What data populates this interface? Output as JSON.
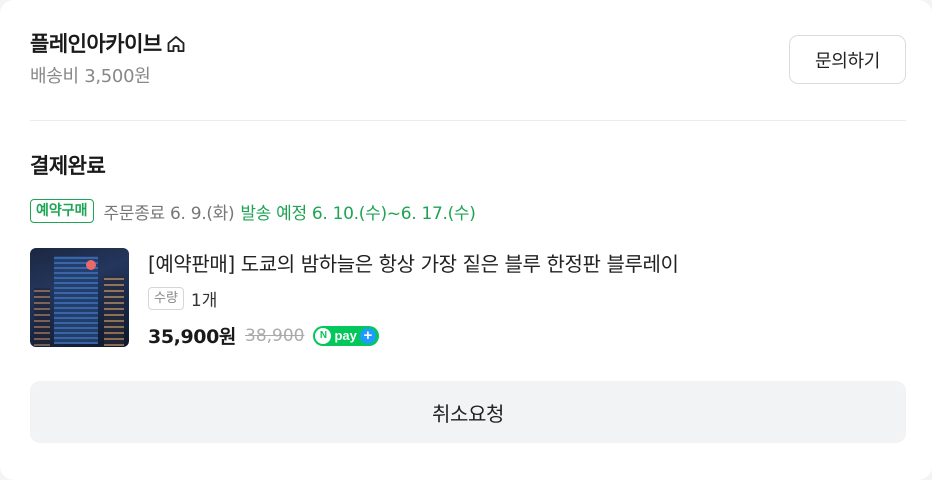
{
  "store": {
    "name": "플레인아카이브",
    "icon": "home-icon",
    "shipping_fee": "배송비 3,500원"
  },
  "header": {
    "inquiry_label": "문의하기"
  },
  "order": {
    "status": "결제완료",
    "badge": "예약구매",
    "order_end": "주문종료 6. 9.(화)",
    "ship_plan": "발송 예정 6. 10.(수)~6. 17.(수)",
    "accent_color": "#1ea454"
  },
  "product": {
    "name": "[예약판매] 도쿄의 밤하늘은 항상 가장 짙은 블루 한정판 블루레이",
    "qty_label": "수량",
    "qty_value": "1개",
    "price": "35,900원",
    "original_price": "38,900",
    "pay_badge": {
      "n": "N",
      "text": "pay",
      "plus": "+"
    }
  },
  "actions": {
    "cancel_label": "취소요청"
  }
}
